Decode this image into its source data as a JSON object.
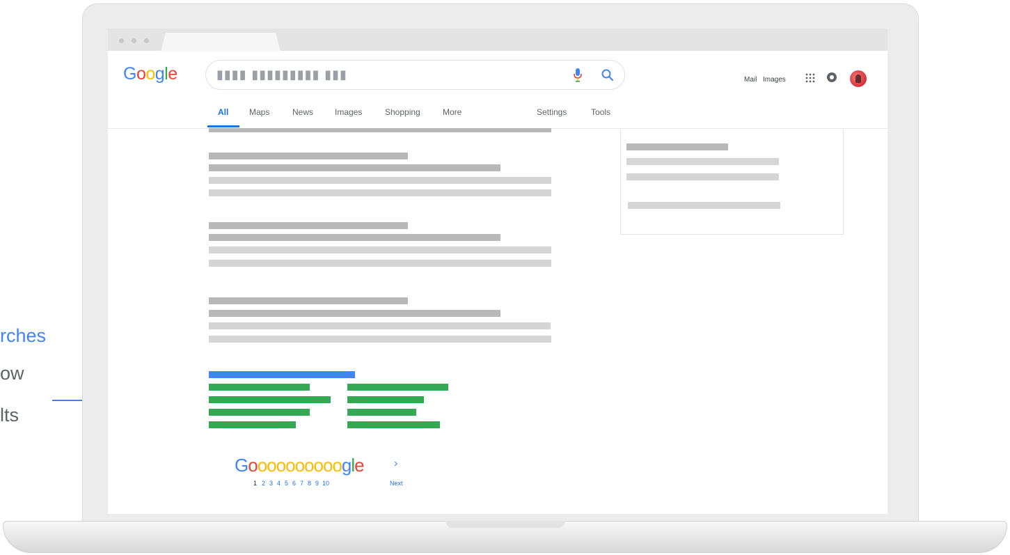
{
  "callout": {
    "line1": "rches",
    "line2": "ow",
    "line3": "lts"
  },
  "brand": {
    "logo_letters": [
      "G",
      "o",
      "o",
      "g",
      "l",
      "e"
    ]
  },
  "search": {
    "query": "▮▮▮▮ ▮▮▮▮▮▮▮▮▮ ▮▮▮"
  },
  "top_links": {
    "mail": "Mail",
    "images": "Images"
  },
  "tabs": [
    {
      "label": "All",
      "active": true
    },
    {
      "label": "Maps"
    },
    {
      "label": "News"
    },
    {
      "label": "Images"
    },
    {
      "label": "Shopping"
    },
    {
      "label": "More"
    },
    {
      "label": "Settings"
    },
    {
      "label": "Tools"
    }
  ],
  "pagination": {
    "logo_letters": [
      "G",
      "o",
      "o",
      "o",
      "o",
      "o",
      "o",
      "o",
      "o",
      "o",
      "o",
      "g",
      "l",
      "e"
    ],
    "pages": [
      "1",
      "2",
      "3",
      "4",
      "5",
      "6",
      "7",
      "8",
      "9",
      "10"
    ],
    "current_page": "1",
    "arrow": "›",
    "next_label": "Next"
  },
  "colors": {
    "blue": "#4285f4",
    "red": "#ea4335",
    "yellow": "#fbbc05",
    "green": "#34a853",
    "related_searches_highlight": "#34a853"
  }
}
